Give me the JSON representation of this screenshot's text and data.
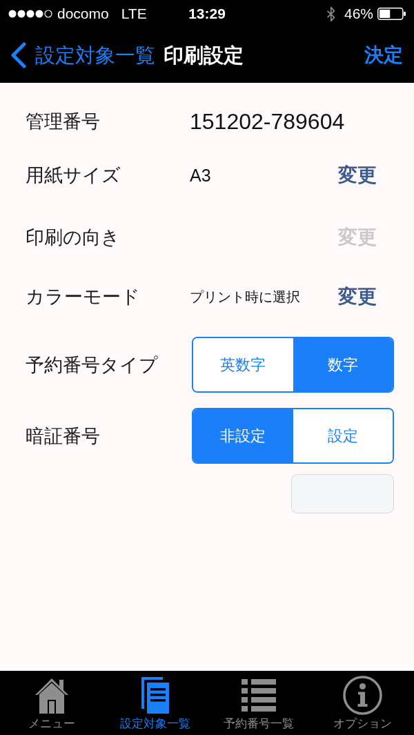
{
  "status_bar": {
    "carrier": "docomo",
    "network": "LTE",
    "time": "13:29",
    "battery": "46%"
  },
  "nav_bar": {
    "back": "設定対象一覧",
    "title": "印刷設定",
    "action": "決定"
  },
  "settings": [
    {
      "kind": "value",
      "label": "管理番号",
      "value": "151202-789604"
    },
    {
      "kind": "change",
      "label": "用紙サイズ",
      "value": "A3",
      "button": {
        "label": "変更",
        "disabled": false
      }
    },
    {
      "kind": "change",
      "label": "印刷の向き",
      "button": {
        "label": "変更",
        "disabled": true
      }
    },
    {
      "kind": "change",
      "label": "カラーモード",
      "value": "プリント時に選択",
      "button": {
        "label": "変更",
        "disabled": false
      }
    },
    {
      "kind": "segmented",
      "label": "予約番号タイプ",
      "options": [
        {
          "label": "英数字",
          "selected": false
        },
        {
          "label": "数字",
          "selected": true
        }
      ]
    },
    {
      "kind": "segmented",
      "label": "暗証番号",
      "options": [
        {
          "label": "非設定",
          "selected": true
        },
        {
          "label": "設定",
          "selected": false
        }
      ],
      "field": {
        "disabled": true
      }
    }
  ],
  "tab_bar": [
    {
      "label": "メニュー",
      "selected": false
    },
    {
      "label": "設定対象一覧",
      "selected": true
    },
    {
      "label": "予約番号一覧",
      "selected": false
    },
    {
      "label": "オプション",
      "selected": false
    }
  ]
}
